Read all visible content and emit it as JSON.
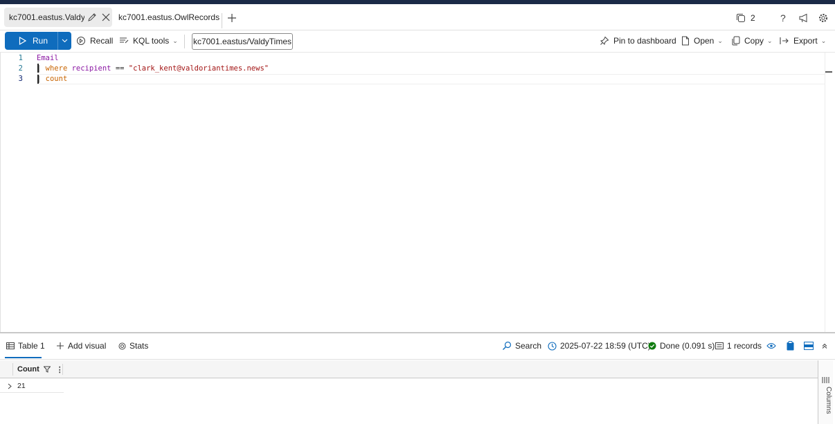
{
  "tabs": [
    {
      "label": "kc7001.eastus.Valdy...",
      "active": true
    },
    {
      "label": "kc7001.eastus.OwlRecords",
      "active": false
    }
  ],
  "tabstrip_right": {
    "copies_count": "2"
  },
  "toolbar": {
    "run_label": "Run",
    "recall_label": "Recall",
    "kql_tools_label": "KQL tools",
    "database": "kc7001.eastus/ValdyTimes",
    "pin_label": "Pin to dashboard",
    "open_label": "Open",
    "copy_label": "Copy",
    "export_label": "Export"
  },
  "editor": {
    "lines": [
      {
        "num": "1",
        "tokens": [
          {
            "t": "Email",
            "c": "table"
          }
        ]
      },
      {
        "num": "2",
        "tokens": [
          {
            "t": "| ",
            "c": "pipe"
          },
          {
            "t": "where",
            "c": "kw"
          },
          {
            "t": " ",
            "c": "op"
          },
          {
            "t": "recipient",
            "c": "ident"
          },
          {
            "t": " == ",
            "c": "op"
          },
          {
            "t": "\"clark_kent@valdoriantimes.news\"",
            "c": "str"
          }
        ]
      },
      {
        "num": "3",
        "tokens": [
          {
            "t": "| ",
            "c": "pipe"
          },
          {
            "t": "count",
            "c": "kw"
          }
        ]
      }
    ]
  },
  "results": {
    "table_tab": "Table 1",
    "add_visual": "Add visual",
    "stats": "Stats",
    "search": "Search",
    "timestamp": "2025-07-22 18:59 (UTC)",
    "status": "Done (0.091 s)",
    "records": "1 records",
    "columns": [
      "Count"
    ],
    "rows": [
      [
        "21"
      ]
    ],
    "side_panel": "Columns"
  },
  "colors": {
    "accent": "#0f6cbd",
    "success": "#107c10",
    "topbar": "#1b2a47"
  }
}
